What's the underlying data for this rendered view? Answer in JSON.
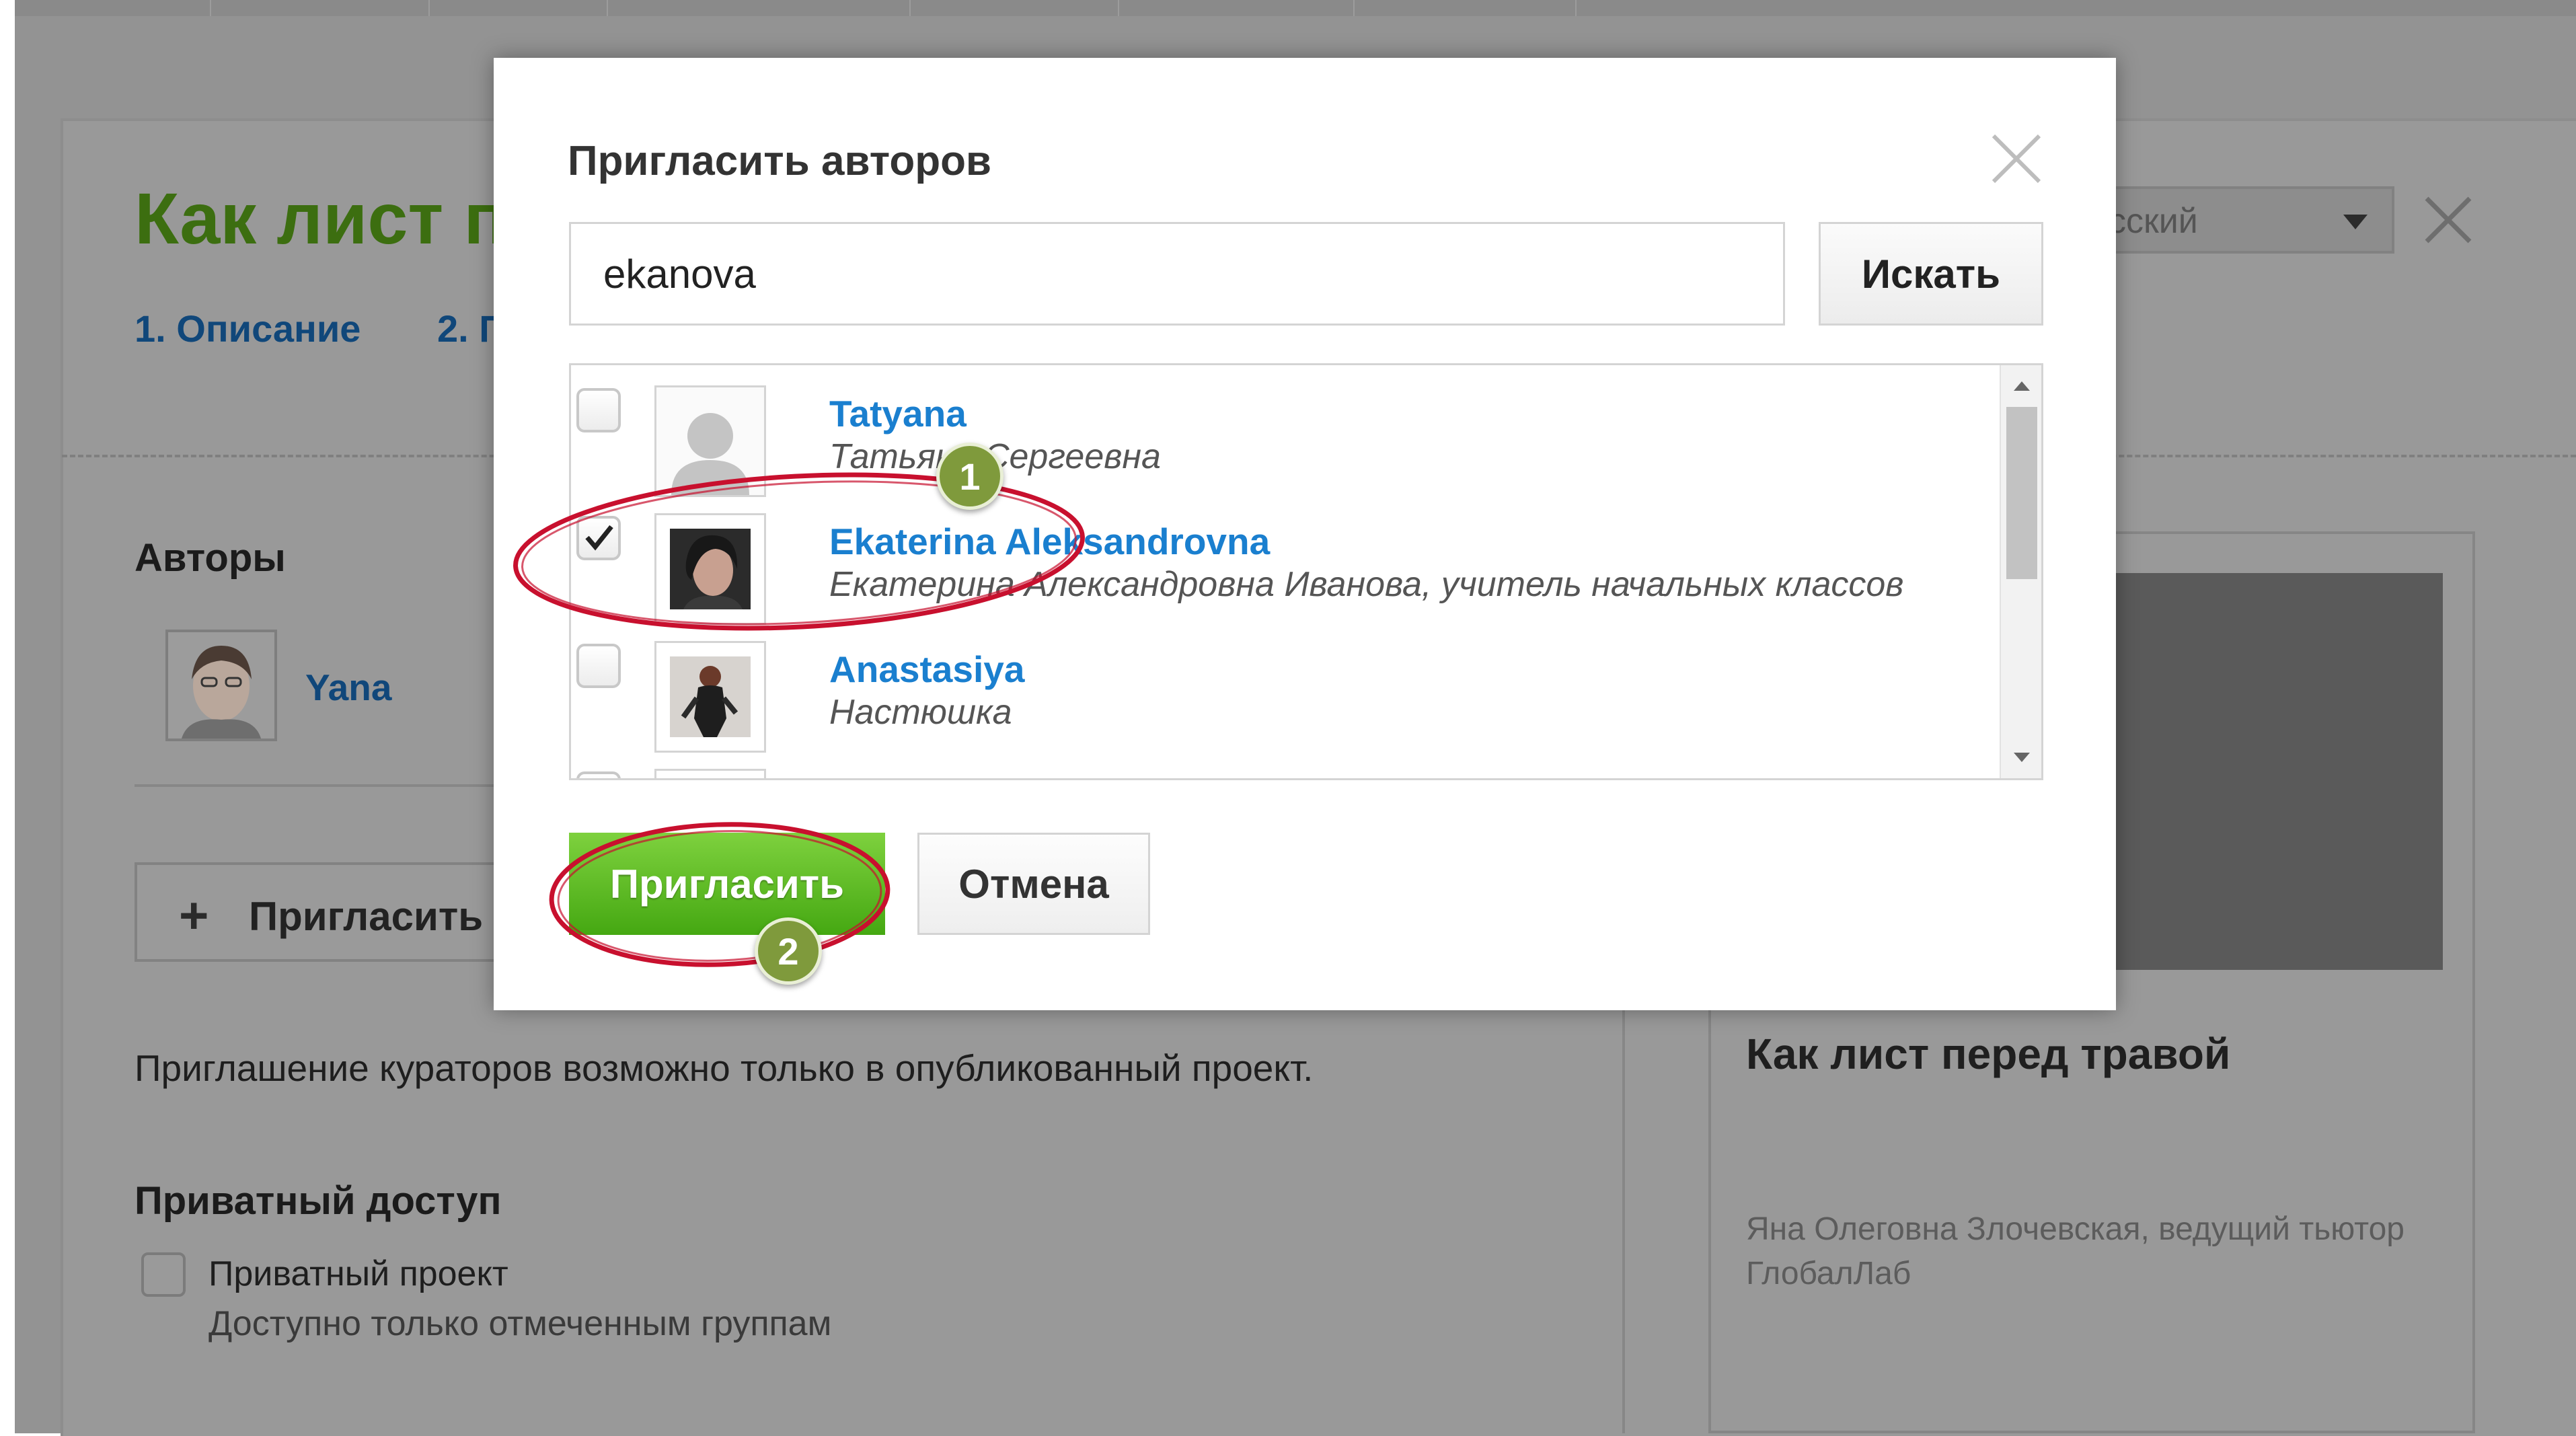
{
  "background": {
    "project_title": "Как лист п",
    "steps": [
      "1. Описание",
      "2. П"
    ],
    "language_select": "сский",
    "authors_heading": "Авторы",
    "author_name": "Yana",
    "invite_button": "Пригласить",
    "curators_notice": "Приглашение кураторов возможно только в опубликованный проект.",
    "private_heading": "Приватный доступ",
    "private_checkbox_label": "Приватный проект",
    "private_checkbox_hint": "Доступно только отмеченным группам",
    "preview": {
      "title": "Как лист перед травой",
      "author_line1": "Яна Олеговна Злочевская, ведущий тьютор",
      "author_line2": "ГлобалЛаб"
    }
  },
  "modal": {
    "title": "Пригласить авторов",
    "search": {
      "value": "ekanova",
      "button": "Искать"
    },
    "results": [
      {
        "name": "Tatyana",
        "description": "Татьяна Сергеевна",
        "checked": false,
        "avatar": "default-user-icon"
      },
      {
        "name": "Ekaterina Aleksandrovna",
        "description": "Екатерина Александровна Иванова, учитель начальных классов",
        "checked": true,
        "avatar": "photo"
      },
      {
        "name": "Anastasiya",
        "description": "Настюшка",
        "checked": false,
        "avatar": "photo"
      }
    ],
    "invite_button": "Пригласить",
    "cancel_button": "Отмена"
  },
  "annotations": {
    "badge1": "1",
    "badge2": "2",
    "color": "#c8102e"
  }
}
